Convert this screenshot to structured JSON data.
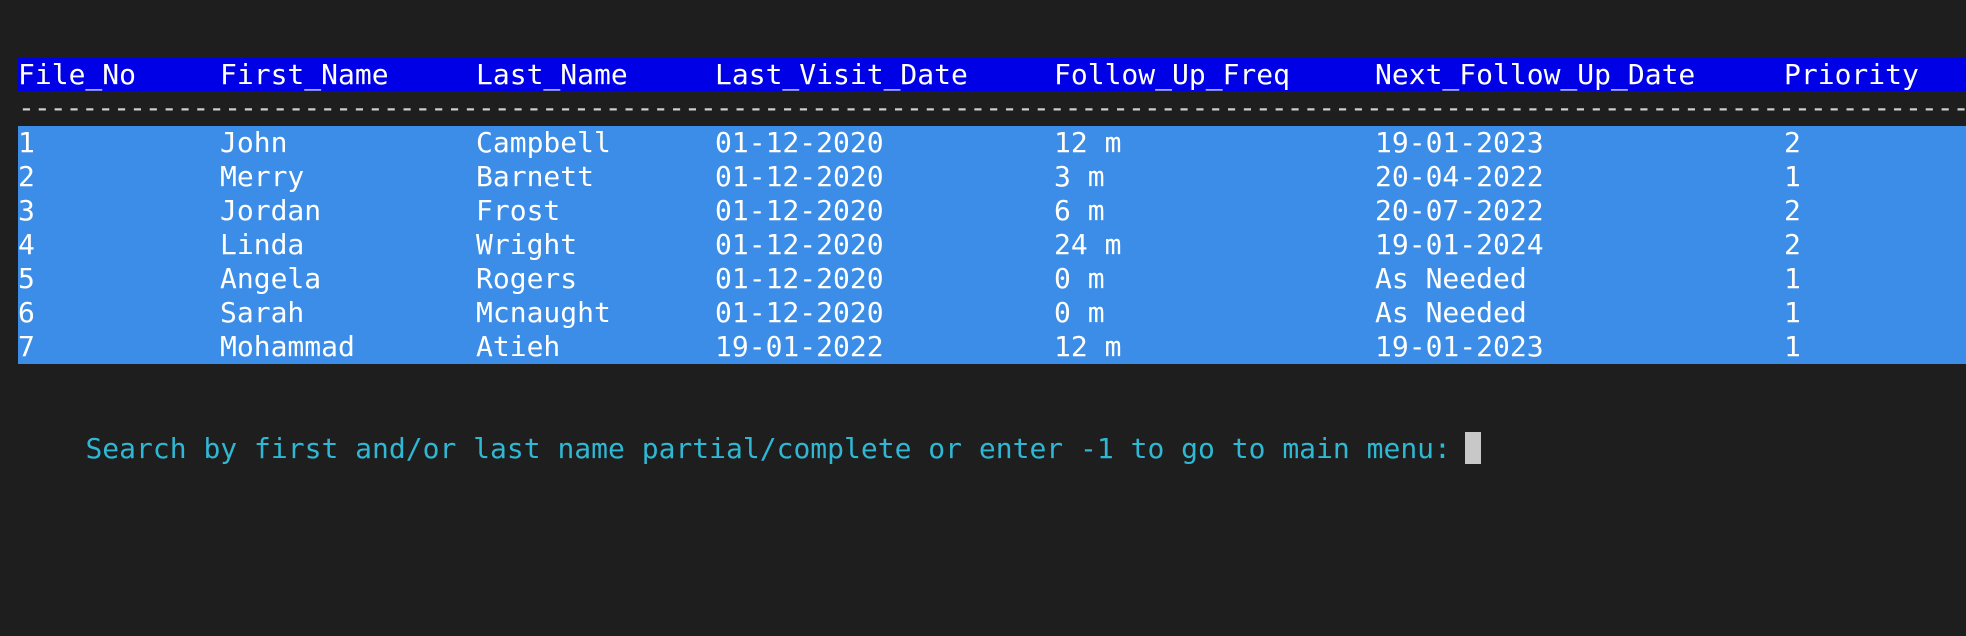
{
  "table": {
    "headers": [
      "File_No",
      "First_Name",
      "Last_Name",
      "Last_Visit_Date",
      "Follow_Up_Freq",
      "Next_Follow_Up_Date",
      "Priority"
    ],
    "separator": "-------------------------------------------------------------------------------------------------------------------------------------------------------",
    "rows": [
      [
        "1",
        "John",
        "Campbell",
        "01-12-2020",
        "12 m",
        "19-01-2023",
        "2"
      ],
      [
        "2",
        "Merry",
        "Barnett",
        "01-12-2020",
        "3 m",
        "20-04-2022",
        "1"
      ],
      [
        "3",
        "Jordan",
        "Frost",
        "01-12-2020",
        "6 m",
        "20-07-2022",
        "2"
      ],
      [
        "4",
        "Linda",
        "Wright",
        "01-12-2020",
        "24 m",
        "19-01-2024",
        "2"
      ],
      [
        "5",
        "Angela",
        "Rogers",
        "01-12-2020",
        "0 m",
        "As Needed",
        "1"
      ],
      [
        "6",
        "Sarah",
        "Mcnaught",
        "01-12-2020",
        "0 m",
        "As Needed",
        "1"
      ],
      [
        "7",
        "Mohammad",
        "Atieh",
        "19-01-2022",
        "12 m",
        "19-01-2023",
        "1"
      ]
    ]
  },
  "prompt": {
    "text": "Search by first and/or last name partial/complete or enter -1 to go to main menu:"
  },
  "colors": {
    "background": "#1e1e1e",
    "header_bg": "#0000e6",
    "rows_bg": "#3b8de8",
    "prompt_text": "#2fb7d3"
  }
}
